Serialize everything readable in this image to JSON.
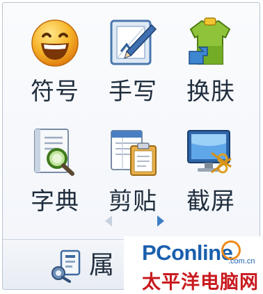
{
  "toolbox": {
    "tools": [
      {
        "label": "符号",
        "icon": "smiley-icon"
      },
      {
        "label": "手写",
        "icon": "pen-writing-icon"
      },
      {
        "label": "换肤",
        "icon": "skin-shirt-icon"
      },
      {
        "label": "字典",
        "icon": "dictionary-search-icon"
      },
      {
        "label": "剪贴",
        "icon": "clipboard-icon"
      },
      {
        "label": "截屏",
        "icon": "screenshot-monitor-icon"
      }
    ],
    "pager": {
      "prev": "arrow-left-icon",
      "next": "arrow-right-icon"
    }
  },
  "bottom_bar": {
    "properties_label": "属",
    "properties_icon": "settings-wrench-icon"
  },
  "watermark": {
    "brand": "PConline",
    "domain": ".com.cn",
    "subtitle": "太平洋电脑网"
  },
  "colors": {
    "panel_border": "#b7c3d3",
    "label_text": "#1f2d3d",
    "accent_blue": "#3d7fc4",
    "watermark_blue": "#1b5fae",
    "watermark_red": "#c8191e",
    "watermark_orange": "#f08a1c"
  }
}
